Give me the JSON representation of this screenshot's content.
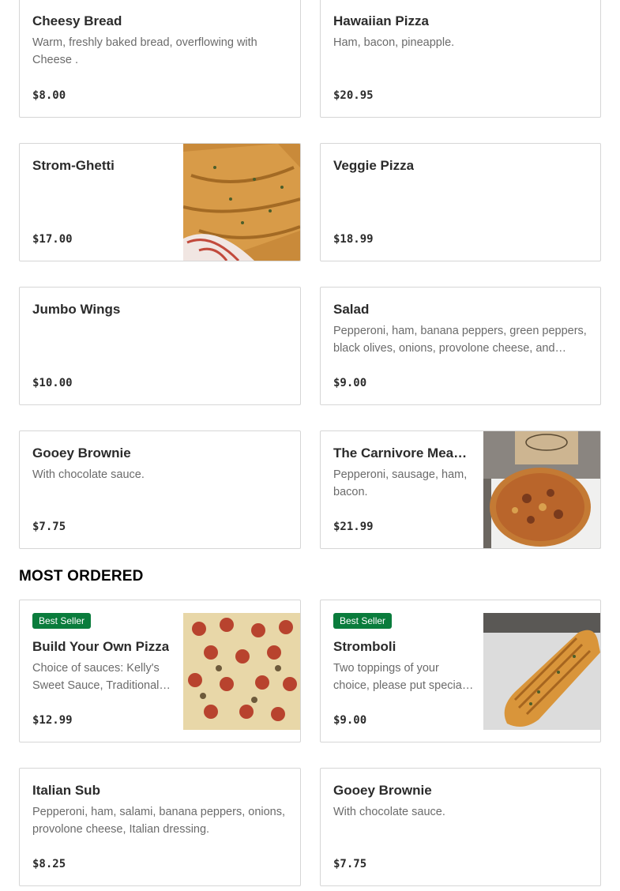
{
  "menu_items": [
    {
      "name": "Cheesy Bread",
      "description": "Warm, freshly baked bread, overflowing with Cheese .",
      "price": "$8.00"
    },
    {
      "name": "Hawaiian Pizza",
      "description": "Ham, bacon, pineapple.",
      "price": "$20.95"
    },
    {
      "name": "Strom-Ghetti",
      "description": "",
      "price": "$17.00"
    },
    {
      "name": "Veggie Pizza",
      "description": "",
      "price": "$18.99"
    },
    {
      "name": "Jumbo Wings",
      "description": "",
      "price": "$10.00"
    },
    {
      "name": "Salad",
      "description": "Pepperoni, ham, banana peppers, green peppers, black olives, onions, provolone cheese, and your…",
      "price": "$9.00"
    },
    {
      "name": "Gooey Brownie",
      "description": "With chocolate sauce.",
      "price": "$7.75"
    },
    {
      "name": "The Carnivore Meat…",
      "description": "Pepperoni, sausage, ham, bacon.",
      "price": "$21.99"
    }
  ],
  "most_ordered": {
    "title": "MOST ORDERED",
    "items": [
      {
        "badge": "Best Seller",
        "name": "Build Your Own Pizza",
        "description": "Choice of sauces: Kelly's Sweet Sauce, Traditional…",
        "price": "$12.99"
      },
      {
        "badge": "Best Seller",
        "name": "Stromboli",
        "description": "Two toppings of your choice, please put specia…",
        "price": "$9.00"
      },
      {
        "name": "Italian Sub",
        "description": "Pepperoni, ham, salami, banana peppers, onions, provolone cheese, Italian dressing.",
        "price": "$8.25"
      },
      {
        "name": "Gooey Brownie",
        "description": "With chocolate sauce.",
        "price": "$7.75"
      }
    ]
  },
  "colors": {
    "badge": "#0a7c3c",
    "border": "#d6d6d6",
    "text": "#2b2b2b",
    "muted": "#6b6b6b"
  }
}
